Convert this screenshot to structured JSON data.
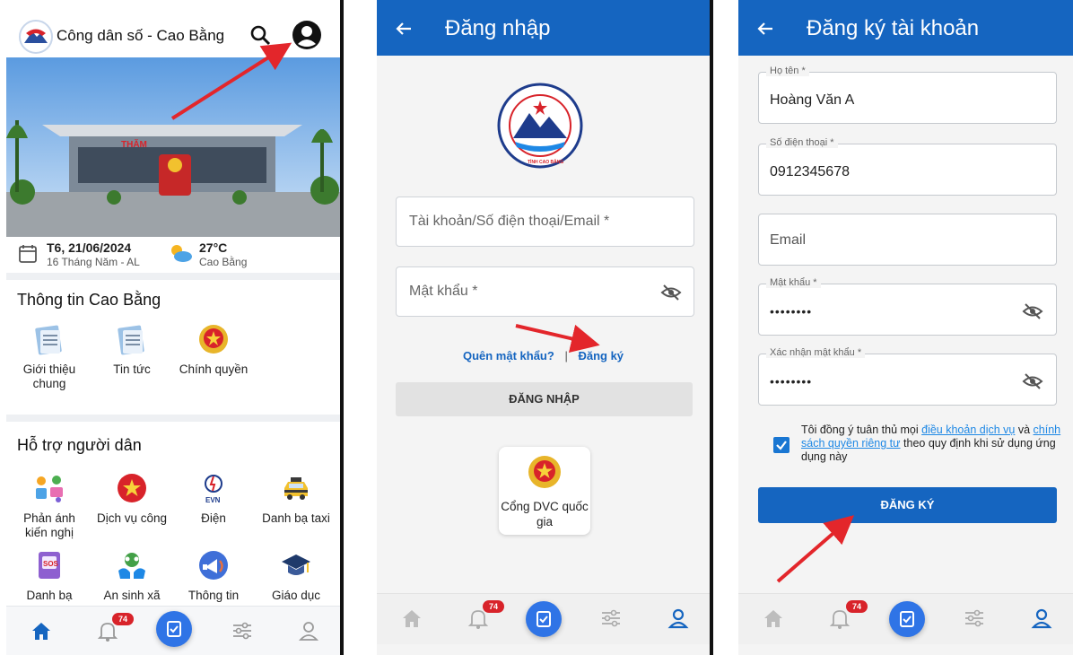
{
  "screen1": {
    "app_title": "Công dân số - Cao Bằng",
    "date": "T6, 21/06/2024",
    "lunar_date": "16 Tháng Năm - AL",
    "temperature": "27°C",
    "location": "Cao Bằng",
    "banner_sign": "THĂM",
    "section1_title": "Thông tin Cao Bằng",
    "section1_tiles": [
      {
        "label": "Giới thiệu chung",
        "icon": "newspaper-icon"
      },
      {
        "label": "Tin tức",
        "icon": "newspaper-icon"
      },
      {
        "label": "Chính quyền",
        "icon": "state-emblem-icon"
      }
    ],
    "section2_title": "Hỗ trợ người dân",
    "section2_tiles": [
      {
        "label": "Phản ánh kiến nghị",
        "icon": "feedback-icon"
      },
      {
        "label": "Dịch vụ công",
        "icon": "public-service-icon"
      },
      {
        "label": "Điện",
        "icon": "evn-icon",
        "icon_text": "EVN"
      },
      {
        "label": "Danh bạ taxi",
        "icon": "taxi-icon"
      },
      {
        "label": "Danh bạ",
        "icon": "sos-phonebook-icon",
        "icon_text": "SOS"
      },
      {
        "label": "An sinh xã",
        "icon": "social-welfare-icon"
      },
      {
        "label": "Thông tin",
        "icon": "megaphone-icon"
      },
      {
        "label": "Giáo dục",
        "icon": "graduation-cap-icon"
      }
    ],
    "nav_badge": "74"
  },
  "screen2": {
    "title": "Đăng nhập",
    "emblem_text": "TỈNH CAO BẰNG",
    "account_placeholder": "Tài khoản/Số điện thoại/Email *",
    "password_placeholder": "Mật khẩu *",
    "forgot_link": "Quên mật khẩu?",
    "link_separator": "|",
    "register_link": "Đăng ký",
    "login_button": "ĐĂNG NHẬP",
    "portal_label": "Cổng DVC quốc gia",
    "nav_badge": "74"
  },
  "screen3": {
    "title": "Đăng ký tài khoản",
    "fields": [
      {
        "label": "Họ tên *",
        "value": "Hoàng Văn A"
      },
      {
        "label": "Số điện thoại *",
        "value": "0912345678"
      },
      {
        "label": "",
        "value": "Email"
      },
      {
        "label": "Mật khẩu *",
        "value": "••••••••"
      },
      {
        "label": "Xác nhận mật khẩu *",
        "value": "••••••••"
      }
    ],
    "terms_prefix": "Tôi đồng ý tuân thủ mọi",
    "terms_link1": "điều khoản dịch vụ",
    "terms_and": "và",
    "terms_link2": "chính sách quyền riêng tư",
    "terms_suffix": "theo quy định khi sử dụng ứng dụng này",
    "terms_checked": true,
    "register_button": "ĐĂNG KÝ",
    "nav_badge": "74"
  },
  "colors": {
    "primary": "#1565c0",
    "fab": "#2f74e6",
    "badge": "#d8232a",
    "annotation_arrow": "#e3262b"
  }
}
